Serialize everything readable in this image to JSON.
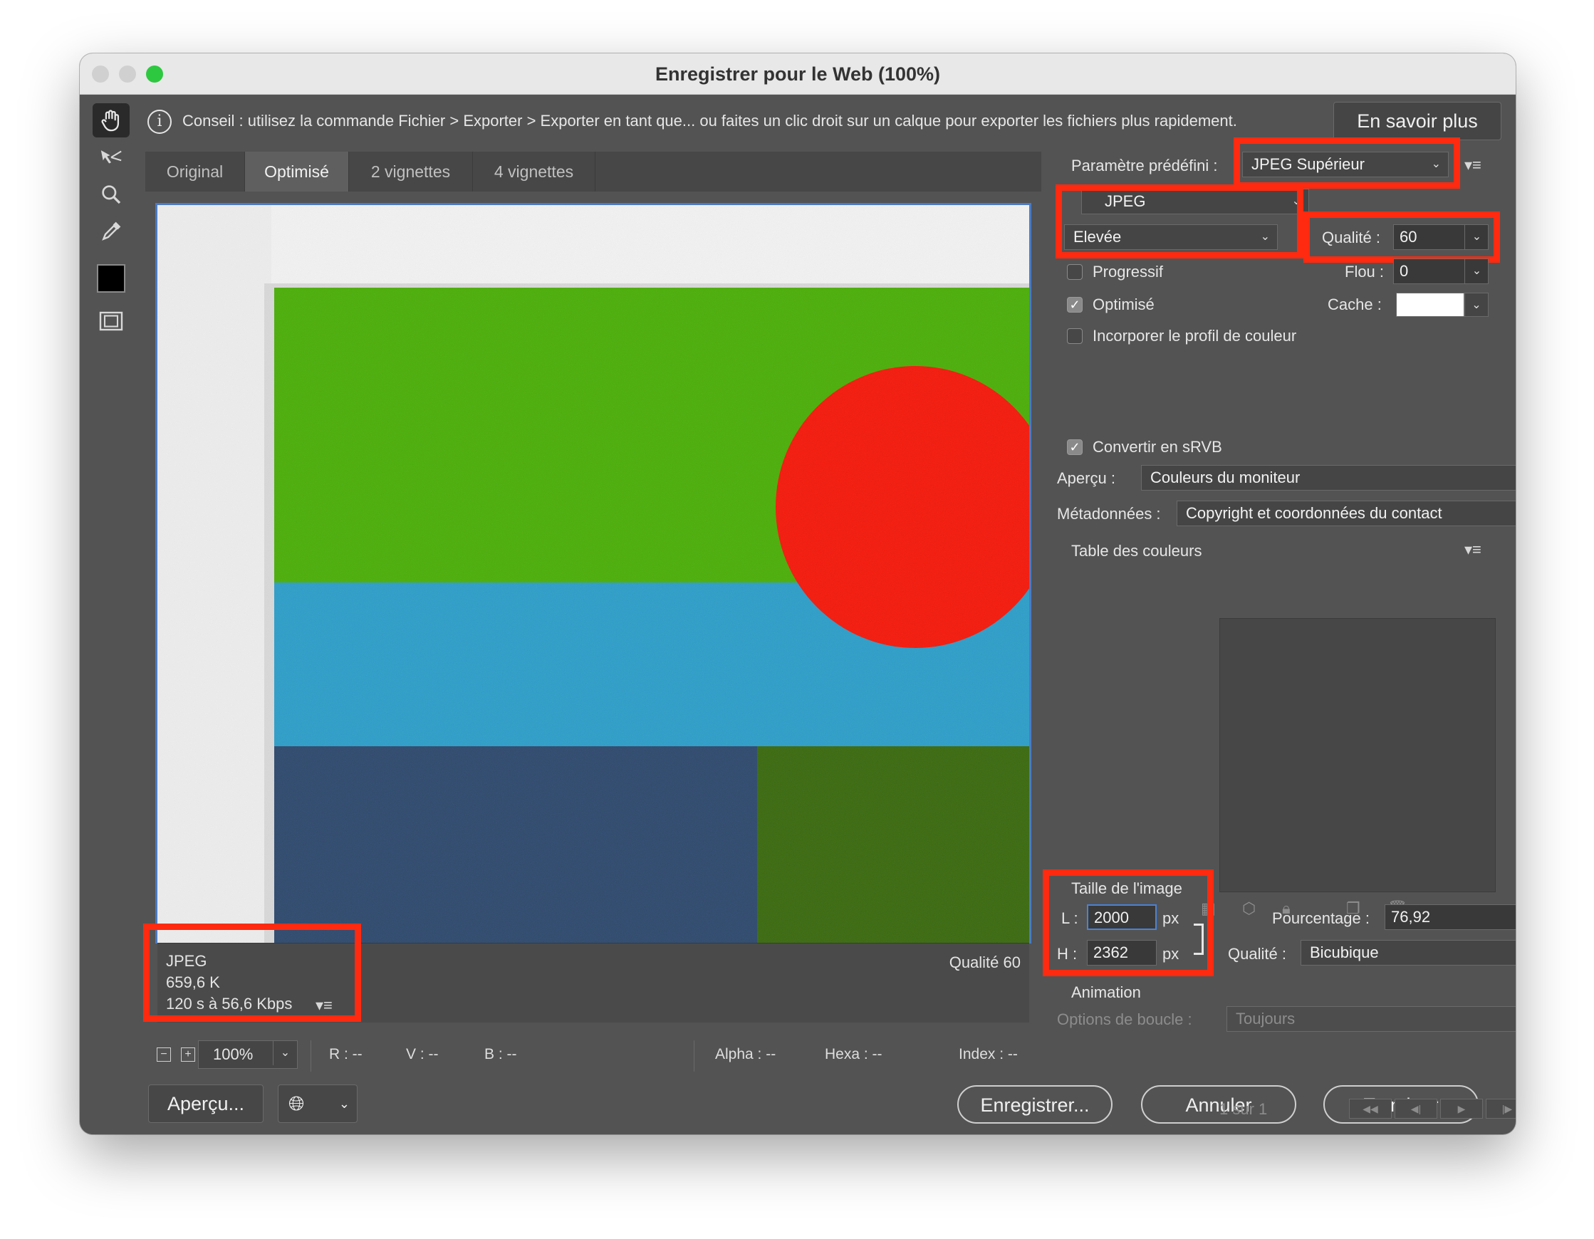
{
  "window": {
    "title": "Enregistrer pour le Web (100%)"
  },
  "tip": {
    "text": "Conseil : utilisez la commande Fichier > Exporter > Exporter en tant que... ou faites un clic droit sur un calque pour exporter les fichiers plus rapidement.",
    "learn_more": "En savoir plus"
  },
  "tabs": [
    {
      "label": "Original"
    },
    {
      "label": "Optimisé"
    },
    {
      "label": "2 vignettes"
    },
    {
      "label": "4 vignettes"
    }
  ],
  "active_tab": "Optimisé",
  "preview": {
    "format": "JPEG",
    "size": "659,6 K",
    "speed": "120 s à 56,6 Kbps",
    "quality": "Qualité 60"
  },
  "status": {
    "zoom": "100%",
    "r": "R : --",
    "v": "V : --",
    "b": "B : --",
    "alpha": "Alpha : --",
    "hexa": "Hexa : --",
    "index": "Index : --"
  },
  "buttons": {
    "preview": "Aperçu...",
    "save": "Enregistrer...",
    "cancel": "Annuler",
    "done": "Terminer"
  },
  "settings": {
    "preset_label": "Paramètre prédéfini :",
    "preset_value": "JPEG Supérieur",
    "format": "JPEG",
    "compression": "Elevée",
    "quality_label": "Qualité :",
    "quality_value": "60",
    "progressive_label": "Progressif",
    "progressive_checked": false,
    "blur_label": "Flou :",
    "blur_value": "0",
    "optimized_label": "Optimisé",
    "optimized_checked": true,
    "matte_label": "Cache :",
    "matte_color": "#ffffff",
    "embed_profile_label": "Incorporer le profil de couleur",
    "embed_profile_checked": false,
    "convert_srgb_label": "Convertir en sRVB",
    "convert_srgb_checked": true,
    "preview_label": "Aperçu :",
    "preview_value": "Couleurs du moniteur",
    "metadata_label": "Métadonnées :",
    "metadata_value": "Copyright et coordonnées du contact",
    "color_table_label": "Table des couleurs"
  },
  "image_size": {
    "title": "Taille de l'image",
    "w_label": "L :",
    "w_value": "2000",
    "h_label": "H :",
    "h_value": "2362",
    "unit": "px",
    "percent_label": "Pourcentage :",
    "percent_value": "76,92",
    "percent_unit": "%",
    "quality_label": "Qualité :",
    "quality_value": "Bicubique"
  },
  "animation": {
    "title": "Animation",
    "loop_label": "Options de boucle :",
    "loop_value": "Toujours",
    "frame": "1 sur 1"
  },
  "colors": {
    "highlight": "#ff2a10",
    "accent": "#4a82d6",
    "green_traffic": "#2ec840"
  }
}
